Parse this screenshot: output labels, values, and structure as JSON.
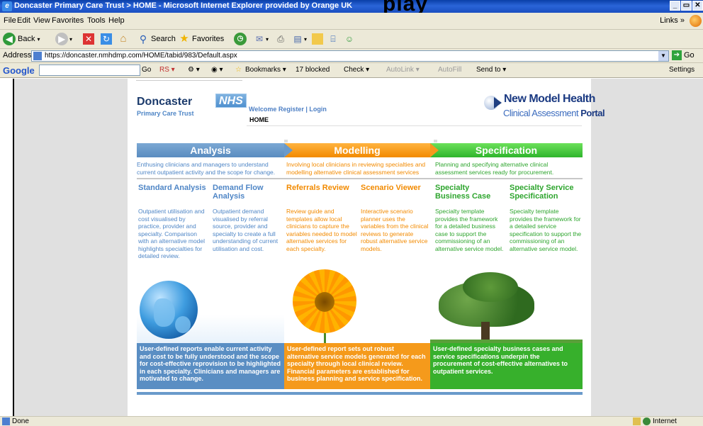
{
  "window": {
    "title": "Doncaster Primary Care Trust > HOME - Microsoft Internet Explorer provided by Orange UK",
    "overlap_heading": "play",
    "buttons": [
      "_",
      "▭",
      "✕"
    ]
  },
  "menu": {
    "items": [
      "File",
      "Edit",
      "View",
      "Favorites",
      "Tools",
      "Help"
    ],
    "links": "Links"
  },
  "toolbar": {
    "back": "Back",
    "search": "Search",
    "favorites": "Favorites"
  },
  "address": {
    "label": "Address",
    "url": "https://doncaster.nmhdmp.com/HOME/tabid/983/Default.aspx",
    "go": "Go"
  },
  "google_bar": {
    "logo": "Google",
    "search_label": "Go",
    "rs": "RS",
    "bookmarks": "Bookmarks",
    "blocked": "17 blocked",
    "check": "Check",
    "autolink": "AutoLink",
    "autofill": "AutoFill",
    "send_to": "Send to",
    "settings": "Settings"
  },
  "page": {
    "brand_name": "Doncaster",
    "brand_badge": "NHS",
    "brand_sub": "Primary Care Trust",
    "welcome": "Welcome Register | Login",
    "breadcrumb": "HOME",
    "nmh_title": "New Model Health",
    "nmh_sub_a": "Clinical Assessment ",
    "nmh_sub_b": "Portal",
    "phases": {
      "analysis": {
        "label": "Analysis",
        "desc": "Enthusing clinicians and managers to understand current outpatient activity and the scope for change."
      },
      "modelling": {
        "label": "Modelling",
        "desc": "Involving local clinicians in reviewing specialties and modelling alternative clinical assessment services"
      },
      "specification": {
        "label": "Specification",
        "desc": "Planning and specifying alternative clinical assessment services ready for procurement."
      }
    },
    "columns": [
      {
        "title": "Standard Analysis",
        "desc": "Outpatient utilisation and cost visualised by practice, provider and specialty. Comparison with an alternative model highlights specialties for detailed review."
      },
      {
        "title": "Demand Flow Analysis",
        "desc": "Outpatient demand visualised by referral source, provider and specialty to create a full understanding of current utilisation and cost."
      },
      {
        "title": "Referrals Review",
        "desc": "Review guide and templates allow local clinicians to capture the variables needed to model alternative services for each specialty."
      },
      {
        "title": "Scenario Viewer",
        "desc": "Interactive scenario planner uses the variables from the clinical reviews to generate robust alternative service models."
      },
      {
        "title": "Specialty Business Case",
        "desc": "Specialty template provides the framework for a detailed business case to support the commissioning of an alternative service model."
      },
      {
        "title": "Specialty Service Specification",
        "desc": "Specialty template provides the framework for a detailed service specification to support the commissioning of an alternative service model."
      }
    ],
    "footers": {
      "analysis": "User-defined reports enable current activity and cost to be fully understood and the scope for cost-effective reprovision to be highlighted in each specialty. Clinicians and managers are motivated to change.",
      "modelling": "User-defined report sets out robust alternative service models generated for each specialty through local clinical review. Financial parameters are established for business planning and service specification.",
      "specification": "User-defined specialty business cases and service specifications underpin the procurement of cost-effective alternatives to outpatient services."
    }
  },
  "status": {
    "text": "Done",
    "zone": "Internet"
  },
  "colors": {
    "analysis": "#5a8ec3",
    "modelling": "#f59a1b",
    "specification": "#37b02c",
    "titlebar": "#1a4fc0"
  }
}
